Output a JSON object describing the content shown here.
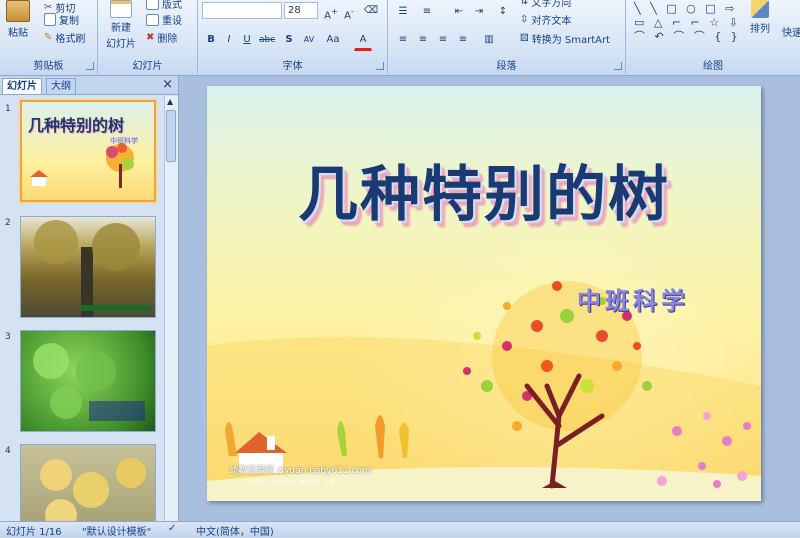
{
  "ribbon": {
    "clipboard": {
      "label": "剪贴板",
      "paste": "粘贴",
      "cut": "剪切",
      "copy": "复制",
      "format_painter": "格式刷"
    },
    "slides": {
      "label": "幻灯片",
      "new_slide_line1": "新建",
      "new_slide_line2": "幻灯片",
      "layout": "版式",
      "reset": "重设",
      "delete": "删除"
    },
    "font": {
      "label": "字体",
      "font_name": "",
      "font_size": "28"
    },
    "paragraph": {
      "label": "段落",
      "text_direction": "文字方向",
      "align_text": "对齐文本",
      "convert_smartart": "转换为 SmartArt"
    },
    "drawing": {
      "label": "绘图",
      "arrange": "排列",
      "quick_styles": "快速"
    }
  },
  "pane": {
    "tabs": [
      "幻灯片",
      "大纲"
    ],
    "close": "×",
    "slide_numbers": [
      "1",
      "2",
      "3",
      "4"
    ],
    "thumb1_title": "几种特别的树",
    "thumb1_sub": "中班科学"
  },
  "slide": {
    "title": "几种特别的树",
    "subtitle": "中班科学",
    "credit": "幼教资源网 ziyuan.baby611.com",
    "credit_small": "PPT课件 · FLASH课件 · 教案反思 · 试题"
  },
  "status": {
    "slide_info": "幻灯片 1/16",
    "theme": "\"默认设计模板\"",
    "language": "中文(简体，中国)"
  },
  "colors": {
    "accent": "#15428b",
    "ribbon_bg": "#d5e3f5",
    "selection": "#f0a43a"
  }
}
